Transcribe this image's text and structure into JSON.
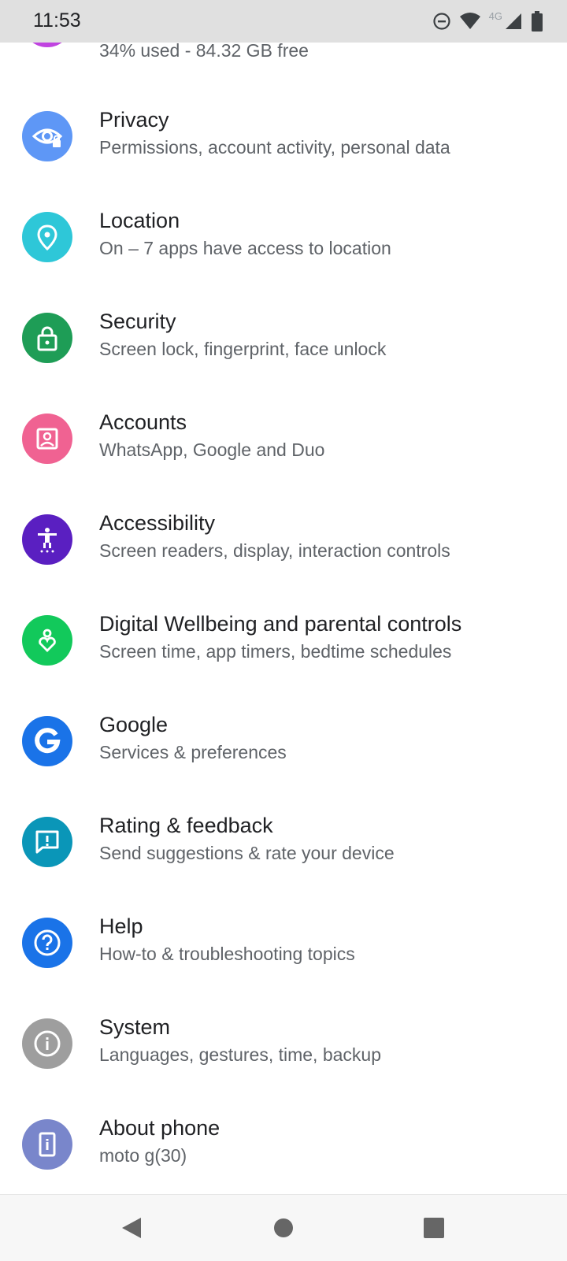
{
  "status_bar": {
    "time": "11:53",
    "network_label": "4G",
    "icons": [
      "do-not-disturb-icon",
      "wifi-icon",
      "cell-signal-icon",
      "battery-icon"
    ]
  },
  "storage_partial": {
    "subtitle": "34% used - 84.32 GB free",
    "icon_color": "#c044e0"
  },
  "settings": [
    {
      "title": "Privacy",
      "subtitle": "Permissions, account activity, personal data",
      "icon": "privacy-eye-icon",
      "color": "#5e97f6"
    },
    {
      "title": "Location",
      "subtitle": "On – 7 apps have access to location",
      "icon": "location-pin-icon",
      "color": "#2ec7d8"
    },
    {
      "title": "Security",
      "subtitle": "Screen lock, fingerprint, face unlock",
      "icon": "lock-icon",
      "color": "#1e9d56"
    },
    {
      "title": "Accounts",
      "subtitle": "WhatsApp, Google and Duo",
      "icon": "account-box-icon",
      "color": "#f06292"
    },
    {
      "title": "Accessibility",
      "subtitle": "Screen readers, display, interaction controls",
      "icon": "accessibility-icon",
      "color": "#5a1fc1"
    },
    {
      "title": "Digital Wellbeing and parental controls",
      "subtitle": "Screen time, app timers, bedtime schedules",
      "icon": "wellbeing-heart-icon",
      "color": "#12c95b"
    },
    {
      "title": "Google",
      "subtitle": "Services & preferences",
      "icon": "google-g-icon",
      "color": "#1a73e8"
    },
    {
      "title": "Rating & feedback",
      "subtitle": "Send suggestions & rate your device",
      "icon": "feedback-icon",
      "color": "#0a96b8"
    },
    {
      "title": "Help",
      "subtitle": "How-to & troubleshooting topics",
      "icon": "help-question-icon",
      "color": "#1a73e8"
    },
    {
      "title": "System",
      "subtitle": "Languages, gestures, time, backup",
      "icon": "info-icon",
      "color": "#9e9e9e"
    },
    {
      "title": "About phone",
      "subtitle": "moto g(30)",
      "icon": "phone-icon",
      "color": "#7986cb"
    }
  ],
  "nav_bar": {
    "icons": [
      "back-icon",
      "home-icon",
      "recents-icon"
    ]
  }
}
